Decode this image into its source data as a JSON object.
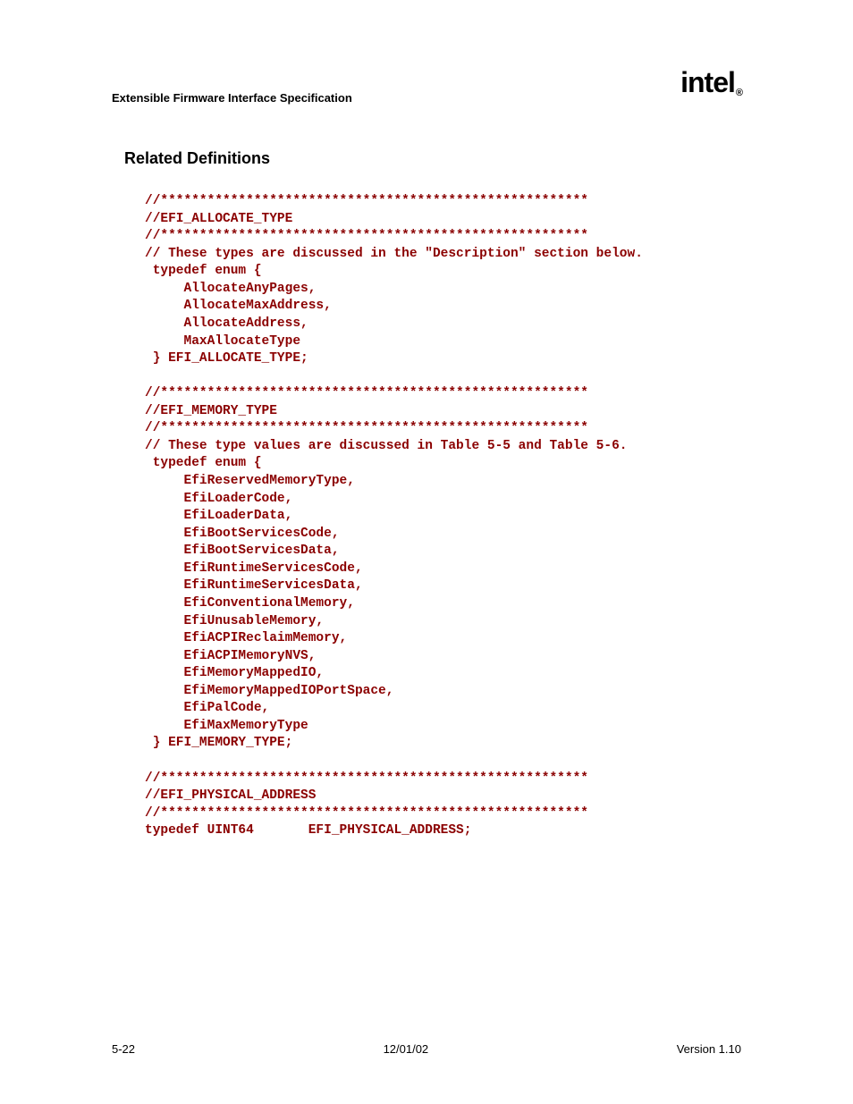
{
  "header": {
    "title": "Extensible Firmware Interface Specification",
    "logo_text": "intel"
  },
  "section": {
    "heading": "Related Definitions"
  },
  "code": {
    "line1": "//*******************************************************",
    "line2": "//EFI_ALLOCATE_TYPE",
    "line3": "//*******************************************************",
    "line4": "// These types are discussed in the \"Description\" section below.",
    "line5": " typedef enum {",
    "line6": "     AllocateAnyPages,",
    "line7": "     AllocateMaxAddress,",
    "line8": "     AllocateAddress,",
    "line9": "     MaxAllocateType",
    "line10": " } EFI_ALLOCATE_TYPE;",
    "line11": "",
    "line12": "//*******************************************************",
    "line13": "//EFI_MEMORY_TYPE",
    "line14": "//*******************************************************",
    "line15": "// These type values are discussed in Table 5-5 and Table 5-6.",
    "line16": " typedef enum {",
    "line17": "     EfiReservedMemoryType,",
    "line18": "     EfiLoaderCode,",
    "line19": "     EfiLoaderData,",
    "line20": "     EfiBootServicesCode,",
    "line21": "     EfiBootServicesData,",
    "line22": "     EfiRuntimeServicesCode,",
    "line23": "     EfiRuntimeServicesData,",
    "line24": "     EfiConventionalMemory,",
    "line25": "     EfiUnusableMemory,",
    "line26": "     EfiACPIReclaimMemory,",
    "line27": "     EfiACPIMemoryNVS,",
    "line28": "     EfiMemoryMappedIO,",
    "line29": "     EfiMemoryMappedIOPortSpace,",
    "line30": "     EfiPalCode,",
    "line31": "     EfiMaxMemoryType",
    "line32": " } EFI_MEMORY_TYPE;",
    "line33": "",
    "line34": "//*******************************************************",
    "line35": "//EFI_PHYSICAL_ADDRESS",
    "line36": "//*******************************************************",
    "line37": "typedef UINT64       EFI_PHYSICAL_ADDRESS;"
  },
  "footer": {
    "page": "5-22",
    "date": "12/01/02",
    "version": "Version 1.10"
  }
}
